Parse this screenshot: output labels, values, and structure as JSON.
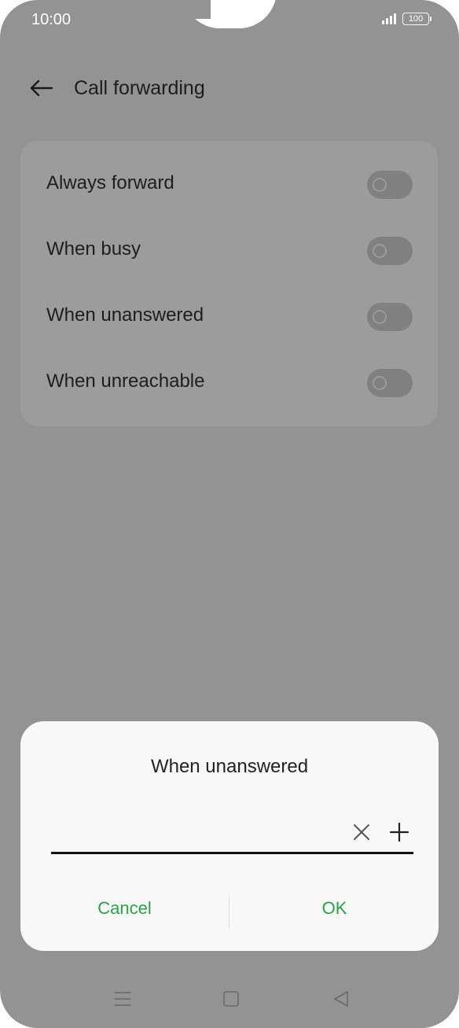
{
  "status_bar": {
    "time": "10:00",
    "battery": "100"
  },
  "header": {
    "title": "Call forwarding"
  },
  "settings": {
    "items": [
      {
        "label": "Always forward",
        "enabled": false
      },
      {
        "label": "When busy",
        "enabled": false
      },
      {
        "label": "When unanswered",
        "enabled": false
      },
      {
        "label": "When unreachable",
        "enabled": false
      }
    ]
  },
  "dialog": {
    "title": "When unanswered",
    "input_value": "",
    "cancel_label": "Cancel",
    "ok_label": "OK"
  },
  "colors": {
    "accent": "#2aa24b",
    "scrim": "#939393",
    "dialog_bg": "#f8f8f8"
  },
  "icons": {
    "back": "arrow-left-icon",
    "clear": "close-icon",
    "add": "plus-icon",
    "nav_menu": "menu-icon",
    "nav_home": "square-icon",
    "nav_back": "triangle-back-icon"
  }
}
